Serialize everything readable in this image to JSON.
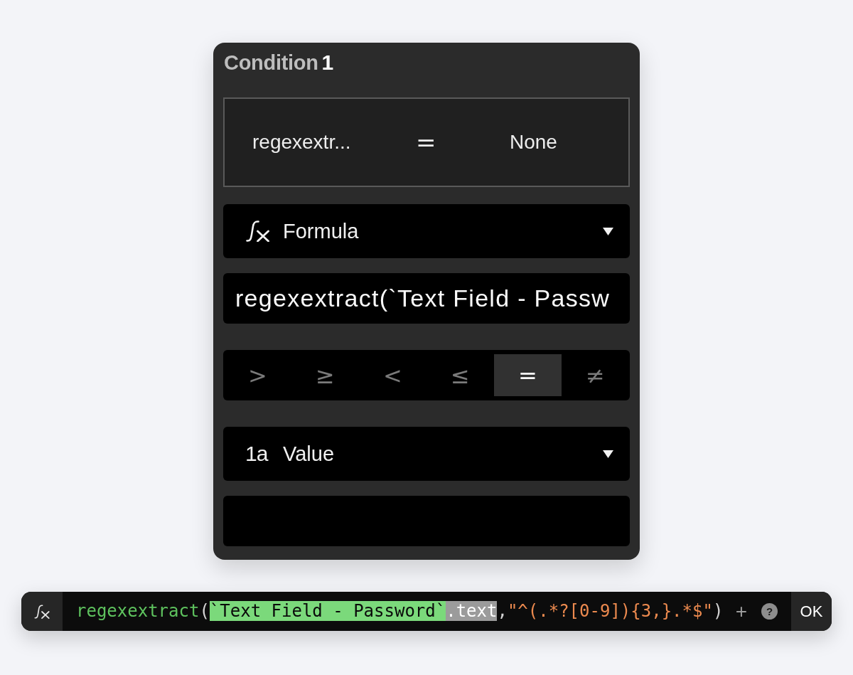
{
  "panel": {
    "title": "Condition",
    "index": "1",
    "summary": {
      "left": "regexextr...",
      "operator": "=",
      "right": "None"
    },
    "left_type": {
      "kind": "formula",
      "label": "Formula"
    },
    "left_input": {
      "value": "regexextract(`Text Field - Passw"
    },
    "operators": [
      {
        "label": ">",
        "selected": false
      },
      {
        "label": "≥",
        "selected": false
      },
      {
        "label": "<",
        "selected": false
      },
      {
        "label": "≤",
        "selected": false
      },
      {
        "label": "=",
        "selected": true
      },
      {
        "label": "≠",
        "selected": false
      }
    ],
    "right_type": {
      "kind": "value",
      "badge": "1a",
      "label": "Value"
    }
  },
  "formula_bar": {
    "tokens": [
      {
        "text": "regexextract",
        "kind": "function"
      },
      {
        "text": "(",
        "kind": "punct"
      },
      {
        "text": "`Text Field - Password`",
        "kind": "reference"
      },
      {
        "text": ".text",
        "kind": "property"
      },
      {
        "text": ",",
        "kind": "punct"
      },
      {
        "text": "\"^(.*?[0-9]){3,}.*$\"",
        "kind": "string"
      },
      {
        "text": ")",
        "kind": "punct"
      }
    ],
    "add": "+",
    "help": "?",
    "ok": "OK"
  }
}
